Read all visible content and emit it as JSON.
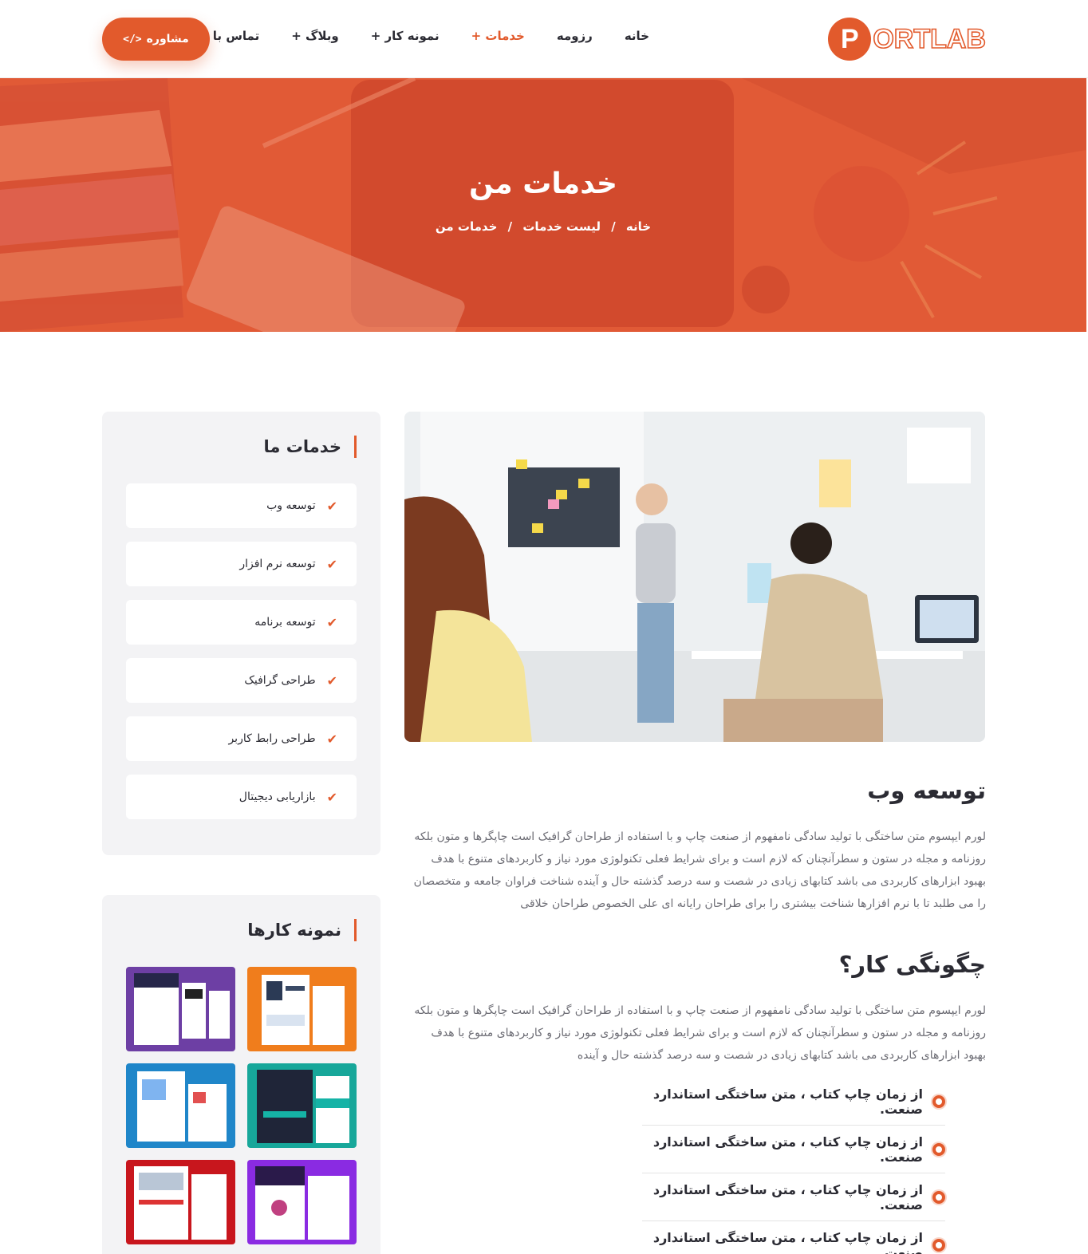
{
  "header": {
    "logo_letter": "P",
    "logo_text": "ORTLAB",
    "nav": [
      "خانه",
      "رزومه",
      "خدمات +",
      "نمونه کار +",
      "وبلاگ +",
      "تماس با ما"
    ],
    "active_nav": "خدمات +",
    "cta_label": "مشاوره",
    "cta_icon": "code-icon"
  },
  "hero": {
    "title": "خدمات من",
    "breadcrumb": [
      "خانه",
      "لیست خدمات",
      "خدمات من"
    ],
    "separator": "/"
  },
  "sidebar": {
    "services_title": "خدمات ما",
    "services": [
      "توسعه وب",
      "توسعه نرم افزار",
      "توسعه برنامه",
      "طراحی گرافیک",
      "طراحی رابط کاربر",
      "بازاریابی دیجیتال"
    ],
    "portfolio_title": "نمونه کارها"
  },
  "content": {
    "section1_title": "توسعه وب",
    "section1_text": "لورم ایپسوم متن ساختگی با تولید سادگی نامفهوم از صنعت چاپ و با استفاده از طراحان گرافیک است چاپگرها و متون بلکه روزنامه و مجله در ستون و سطرآنچنان که لازم است و برای شرایط فعلی تکنولوژی مورد نیاز و کاربردهای متنوع با هدف بهبود ابزارهای کاربردی می باشد کتابهای زیادی در شصت و سه درصد گذشته حال و آینده شناخت فراوان جامعه و متخصصان را می طلبد تا با نرم افزارها شناخت بیشتری را برای طراحان رایانه ای علی الخصوص طراحان خلاقی",
    "section2_title": "چگونگی کار؟",
    "section2_text": "لورم ایپسوم متن ساختگی با تولید سادگی نامفهوم از صنعت چاپ و با استفاده از طراحان گرافیک است چاپگرها و متون بلکه روزنامه و مجله در ستون و سطرآنچنان که لازم است و برای شرایط فعلی تکنولوژی مورد نیاز و کاربردهای متنوع با هدف بهبود ابزارهای کاربردی می باشد کتابهای زیادی در شصت و سه درصد گذشته حال و آینده",
    "bullets": [
      "از زمان چاپ کتاب ، متن ساختگی استاندارد صنعت.",
      "از زمان چاپ کتاب ، متن ساختگی استاندارد صنعت.",
      "از زمان چاپ کتاب ، متن ساختگی استاندارد صنعت.",
      "از زمان چاپ کتاب ، متن ساختگی استاندارد صنعت."
    ]
  },
  "colors": {
    "accent": "#e25a2c",
    "sidebar_bg": "#f3f3f5",
    "text": "#2b2b33",
    "muted": "#6c6c74"
  }
}
